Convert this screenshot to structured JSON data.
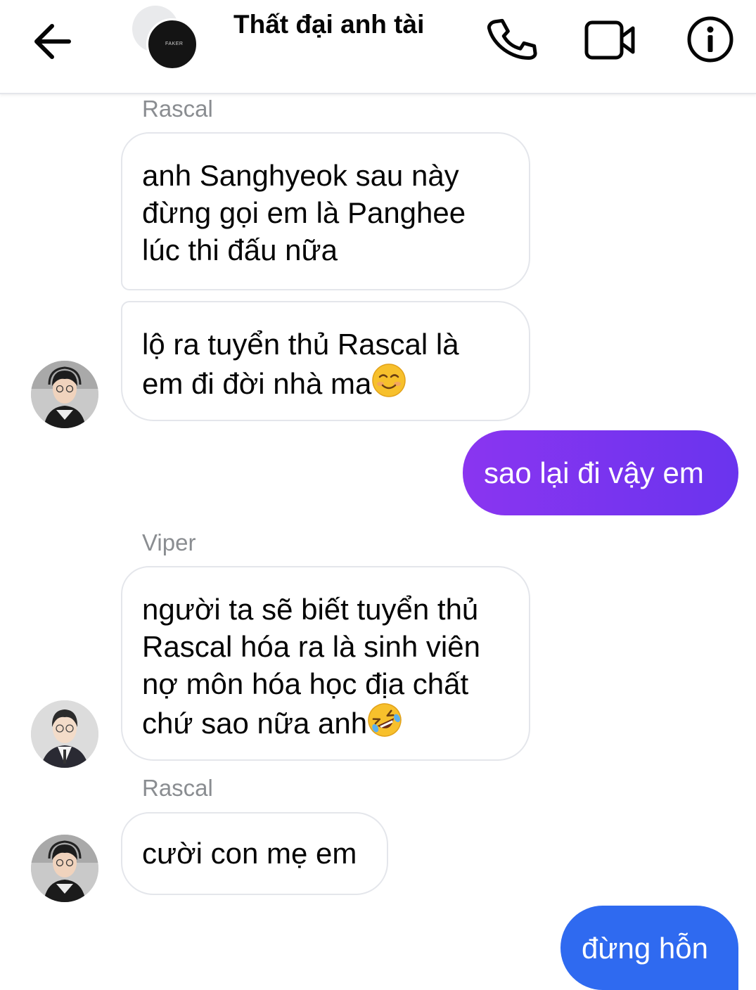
{
  "header": {
    "title": "Thất đại anh tài",
    "icons": [
      "back-arrow-icon",
      "phone-icon",
      "video-camera-icon",
      "info-icon"
    ],
    "avatar_badge_text": "FAKER"
  },
  "messages": [
    {
      "sender": "Rascal"
    },
    {
      "text": "anh Sanghyeok sau này\nđừng gọi em là Panghee\nlúc thi đấu nữa"
    },
    {
      "text": "lộ ra tuyển thủ Rascal là\nem đi đời nhà ma",
      "emoji": "smiling-face-emoji"
    },
    {
      "text": "sao lại đi vậy em",
      "outgoing": true
    },
    {
      "sender": "Viper"
    },
    {
      "text": "người ta sẽ biết tuyển thủ\nRascal hóa ra là sinh viên\nnợ môn hóa học địa chất\nchứ sao nữa anh",
      "emoji": "rolling-laughing-emoji"
    },
    {
      "sender": "Rascal"
    },
    {
      "text": "cười con mẹ em"
    },
    {
      "text": "đừng hỗn",
      "outgoing": true
    }
  ],
  "colors": {
    "outgoing_gradient_start": "#8a35f0",
    "outgoing_gradient_end": "#6a34ee",
    "outgoing_blue": "#2f6af0",
    "sender_name": "#8a8d91",
    "bubble_border": "#e4e6eb"
  }
}
